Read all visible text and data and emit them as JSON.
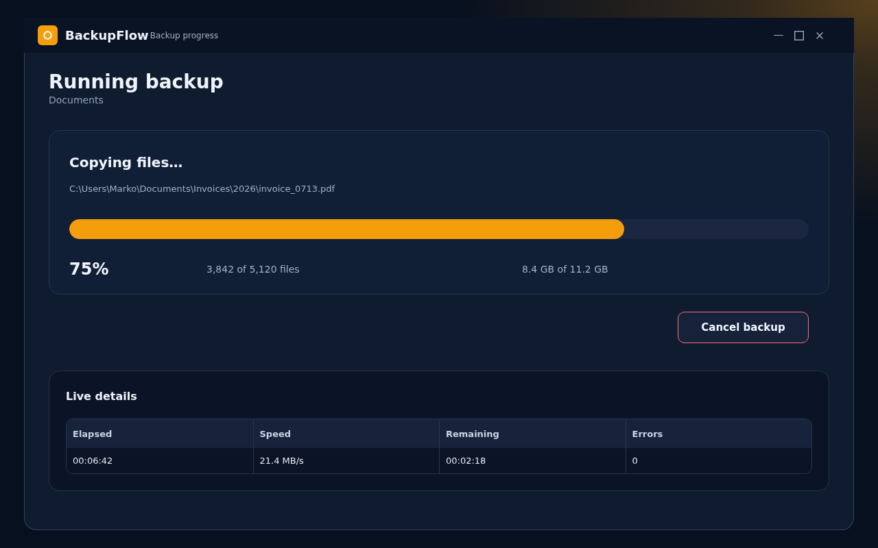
{
  "app": {
    "name": "BackupFlow",
    "subtitle": "Backup progress"
  },
  "window_controls": [
    {
      "kind": "minimize"
    },
    {
      "kind": "maximize"
    },
    {
      "kind": "close"
    }
  ],
  "header": {
    "title": "Running backup",
    "source": "Documents"
  },
  "progress": {
    "status": "Copying files…",
    "current_file": "C:\\Users\\Marko\\Documents\\Invoices\\2026\\invoice_0713.pdf",
    "level": 0.75,
    "percent": "75%",
    "files": "3,842 of 5,120 files",
    "size": "8.4 GB of 11.2 GB"
  },
  "cancel_button": "Cancel backup",
  "live_details": {
    "title": "Live details",
    "table": {
      "columns": [
        "Elapsed",
        "Speed",
        "Remaining",
        "Errors"
      ],
      "rows": [
        [
          "00:06:42",
          "21.4 MB/s",
          "00:02:18",
          "0"
        ]
      ]
    }
  }
}
